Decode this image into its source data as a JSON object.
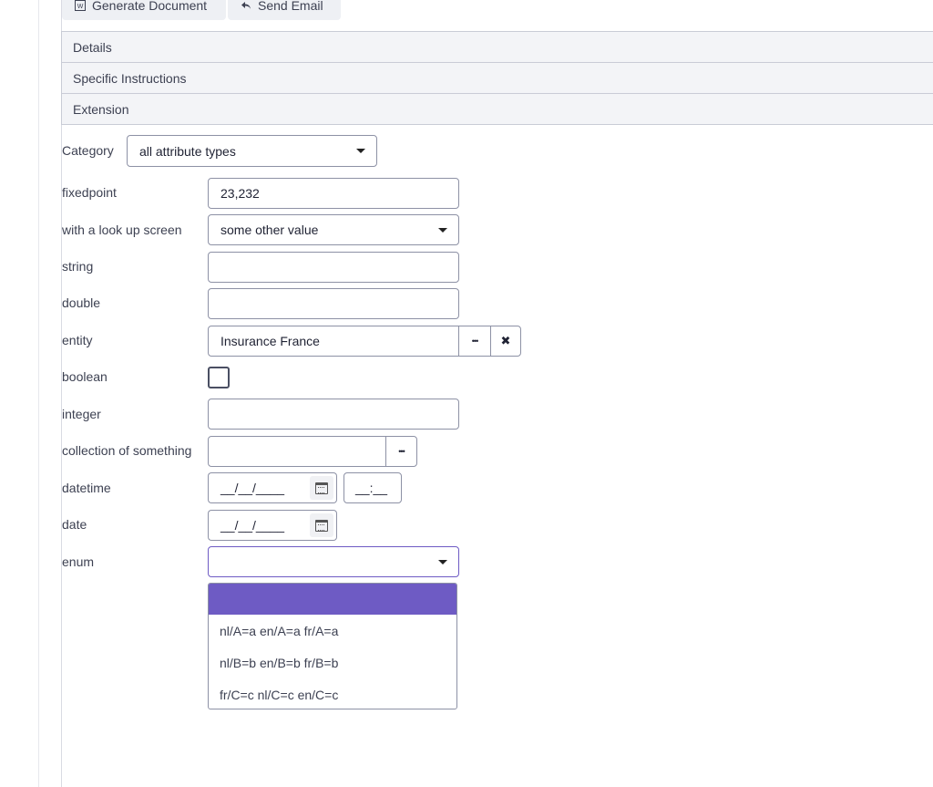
{
  "toolbar": {
    "generate_label": "Generate Document",
    "email_label": "Send Email"
  },
  "sections": {
    "details": "Details",
    "specific": "Specific Instructions",
    "extension": "Extension"
  },
  "form": {
    "category_label": "Category",
    "category_value": "all attribute types",
    "fixedpoint_label": "fixedpoint",
    "fixedpoint_value": "23,232",
    "lookup_label": "with a look up screen",
    "lookup_value": "some other value",
    "string_label": "string",
    "double_label": "double",
    "entity_label": "entity",
    "entity_value": "Insurance France",
    "entity_more": "•••",
    "entity_clear": "✖",
    "boolean_label": "boolean",
    "integer_label": "integer",
    "collection_label": "collection of something",
    "collection_more": "•••",
    "datetime_label": "datetime",
    "date_placeholder": "__/__/____",
    "time_placeholder": "__:__",
    "date_label": "date",
    "enum_label": "enum",
    "enum_options": [
      "nl/A=a en/A=a fr/A=a",
      "nl/B=b en/B=b fr/B=b",
      "fr/C=c nl/C=c en/C=c"
    ]
  }
}
